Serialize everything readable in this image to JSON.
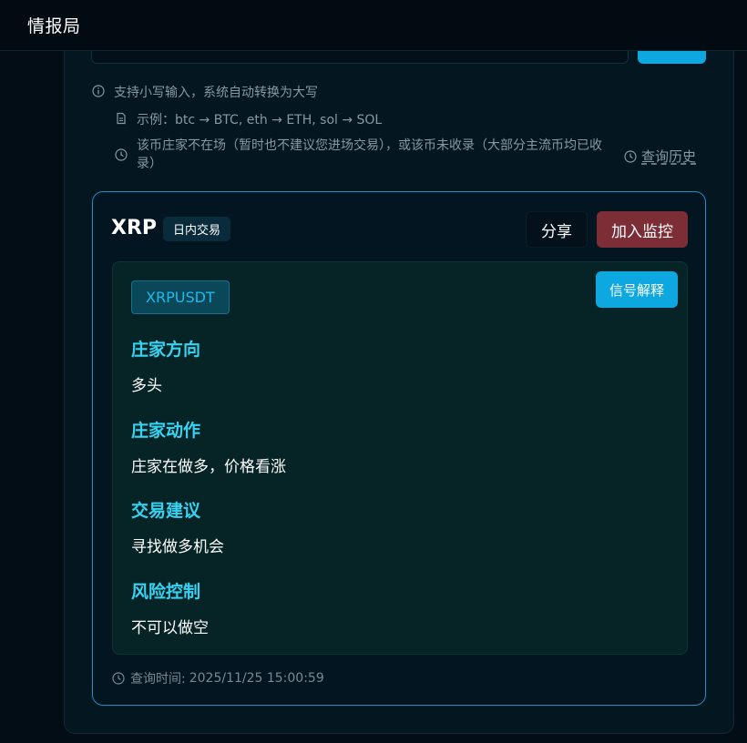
{
  "app": {
    "title": "情报局"
  },
  "hints": {
    "lowercase": "支持小写输入，系统自动转换为大写",
    "example": "示例：btc → BTC, eth → ETH, sol → SOL",
    "absent": "该币庄家不在场（暂时也不建议您进场交易），或该币未收录（大部分主流币均已收录）",
    "history": "查询历史"
  },
  "result": {
    "symbol": "XRP",
    "type": "日内交易",
    "share_label": "分享",
    "monitor_label": "加入监控",
    "pair": "XRPUSDT",
    "explain_label": "信号解释",
    "sections": [
      {
        "title": "庄家方向",
        "value": "多头"
      },
      {
        "title": "庄家动作",
        "value": "庄家在做多，价格看涨"
      },
      {
        "title": "交易建议",
        "value": "寻找做多机会"
      },
      {
        "title": "风险控制",
        "value": "不可以做空"
      }
    ],
    "query_time_label": "查询时间: ",
    "query_time": "2025/11/25 15:00:59"
  },
  "colors": {
    "accent": "#0ea8e0",
    "monitor": "#7d2d36",
    "section_title": "#36d3f2",
    "card_border": "#1f8fc4"
  },
  "icons": [
    "info-icon",
    "document-icon",
    "clock-icon"
  ]
}
